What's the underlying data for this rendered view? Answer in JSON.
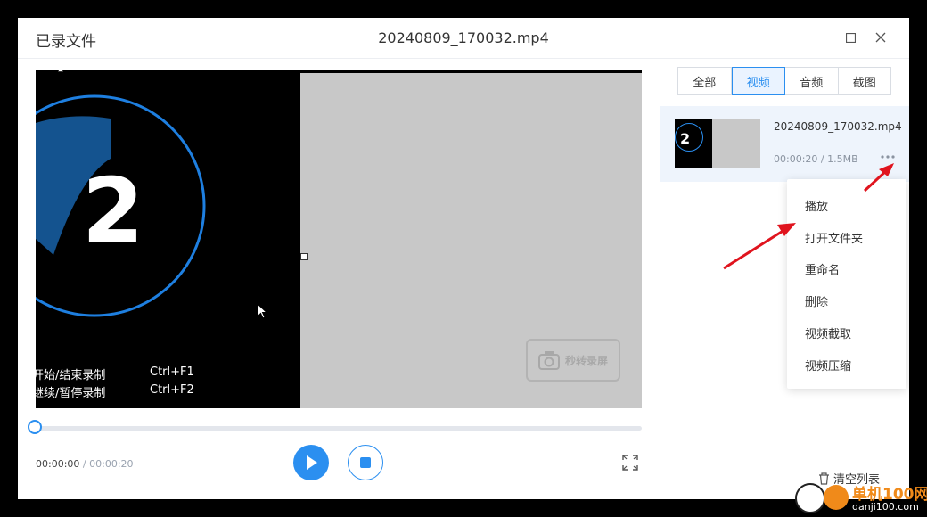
{
  "window": {
    "title": "已录文件",
    "filename": "20240809_170032.mp4"
  },
  "video": {
    "countdown": "2",
    "hotkeys": [
      {
        "action": "开始/结束录制",
        "key": "Ctrl+F1"
      },
      {
        "action": "继续/暂停录制",
        "key": "Ctrl+F2"
      }
    ],
    "watermark": "秒转录屏"
  },
  "player": {
    "current_time": "00:00:00",
    "separator": "/",
    "total_time": "00:00:20",
    "progress": 0
  },
  "tabs": [
    {
      "label": "全部",
      "active": false
    },
    {
      "label": "视频",
      "active": true
    },
    {
      "label": "音频",
      "active": false
    },
    {
      "label": "截图",
      "active": false
    }
  ],
  "file_list": [
    {
      "name": "20240809_170032.mp4",
      "meta": "00:00:20 / 1.5MB"
    }
  ],
  "context_menu": [
    "播放",
    "打开文件夹",
    "重命名",
    "删除",
    "视频截取",
    "视频压缩"
  ],
  "footer": {
    "clear_label": "清空列表"
  },
  "site_logo": {
    "cn": "单机100网",
    "en": "danji100.com"
  },
  "colors": {
    "accent": "#2b8ff0",
    "arrow": "#e0141e",
    "logo_orange": "#f08a1a"
  }
}
